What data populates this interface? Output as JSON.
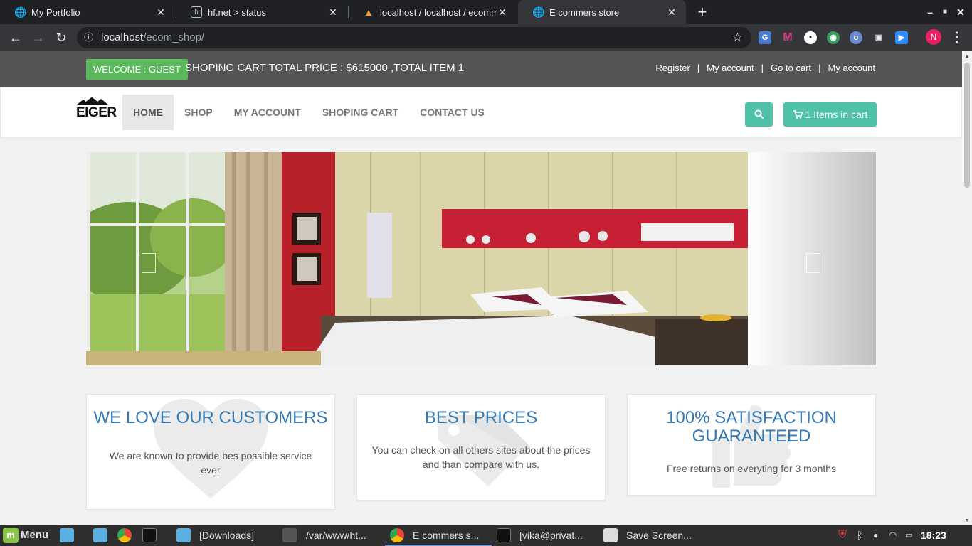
{
  "browser": {
    "tabs": [
      {
        "title": "My Portfolio",
        "icon": "globe-icon",
        "active": false
      },
      {
        "title": "hf.net > status",
        "icon": "hf-icon",
        "active": false
      },
      {
        "title": "localhost / localhost / ecommer",
        "icon": "phpmyadmin-icon",
        "active": false
      },
      {
        "title": "E commers store",
        "icon": "globe-icon",
        "active": true
      }
    ],
    "url_host": "localhost",
    "url_path": "/ecom_shop/"
  },
  "site": {
    "welcome": "WELCOME : GUEST",
    "cart_summary": "SHOPING CART TOTAL PRICE : $615000 ,TOTAL ITEM 1",
    "top_links": [
      "Register",
      "My account",
      "Go to cart",
      "My account"
    ],
    "logo_text": "EIGER",
    "menu": [
      "HOME",
      "SHOP",
      "MY ACCOUNT",
      "SHOPING CART",
      "CONTACT US"
    ],
    "active_menu": "HOME",
    "cart_button": "1 Items in cart",
    "features": [
      {
        "title": "WE LOVE OUR CUSTOMERS",
        "text": "We are known to provide bes possible service ever",
        "icon": "heart-icon"
      },
      {
        "title": "BEST PRICES",
        "text": "You can check on all others sites about the prices and than compare with us.",
        "icon": "tag-icon"
      },
      {
        "title": "100% SATISFACTION GUARANTEED",
        "text": "Free returns on everyting for 3 months",
        "icon": "thumbs-up-icon"
      }
    ]
  },
  "taskbar": {
    "menu_label": "Menu",
    "windows": [
      "[Downloads]",
      "/var/www/ht...",
      "E commers s...",
      "[vika@privat...",
      "Save Screen..."
    ],
    "clock": "18:23"
  },
  "colors": {
    "accent": "#4fc1a9",
    "welcome_green": "#5cb85c",
    "feature_title": "#337ab7",
    "topbar": "#555555"
  }
}
